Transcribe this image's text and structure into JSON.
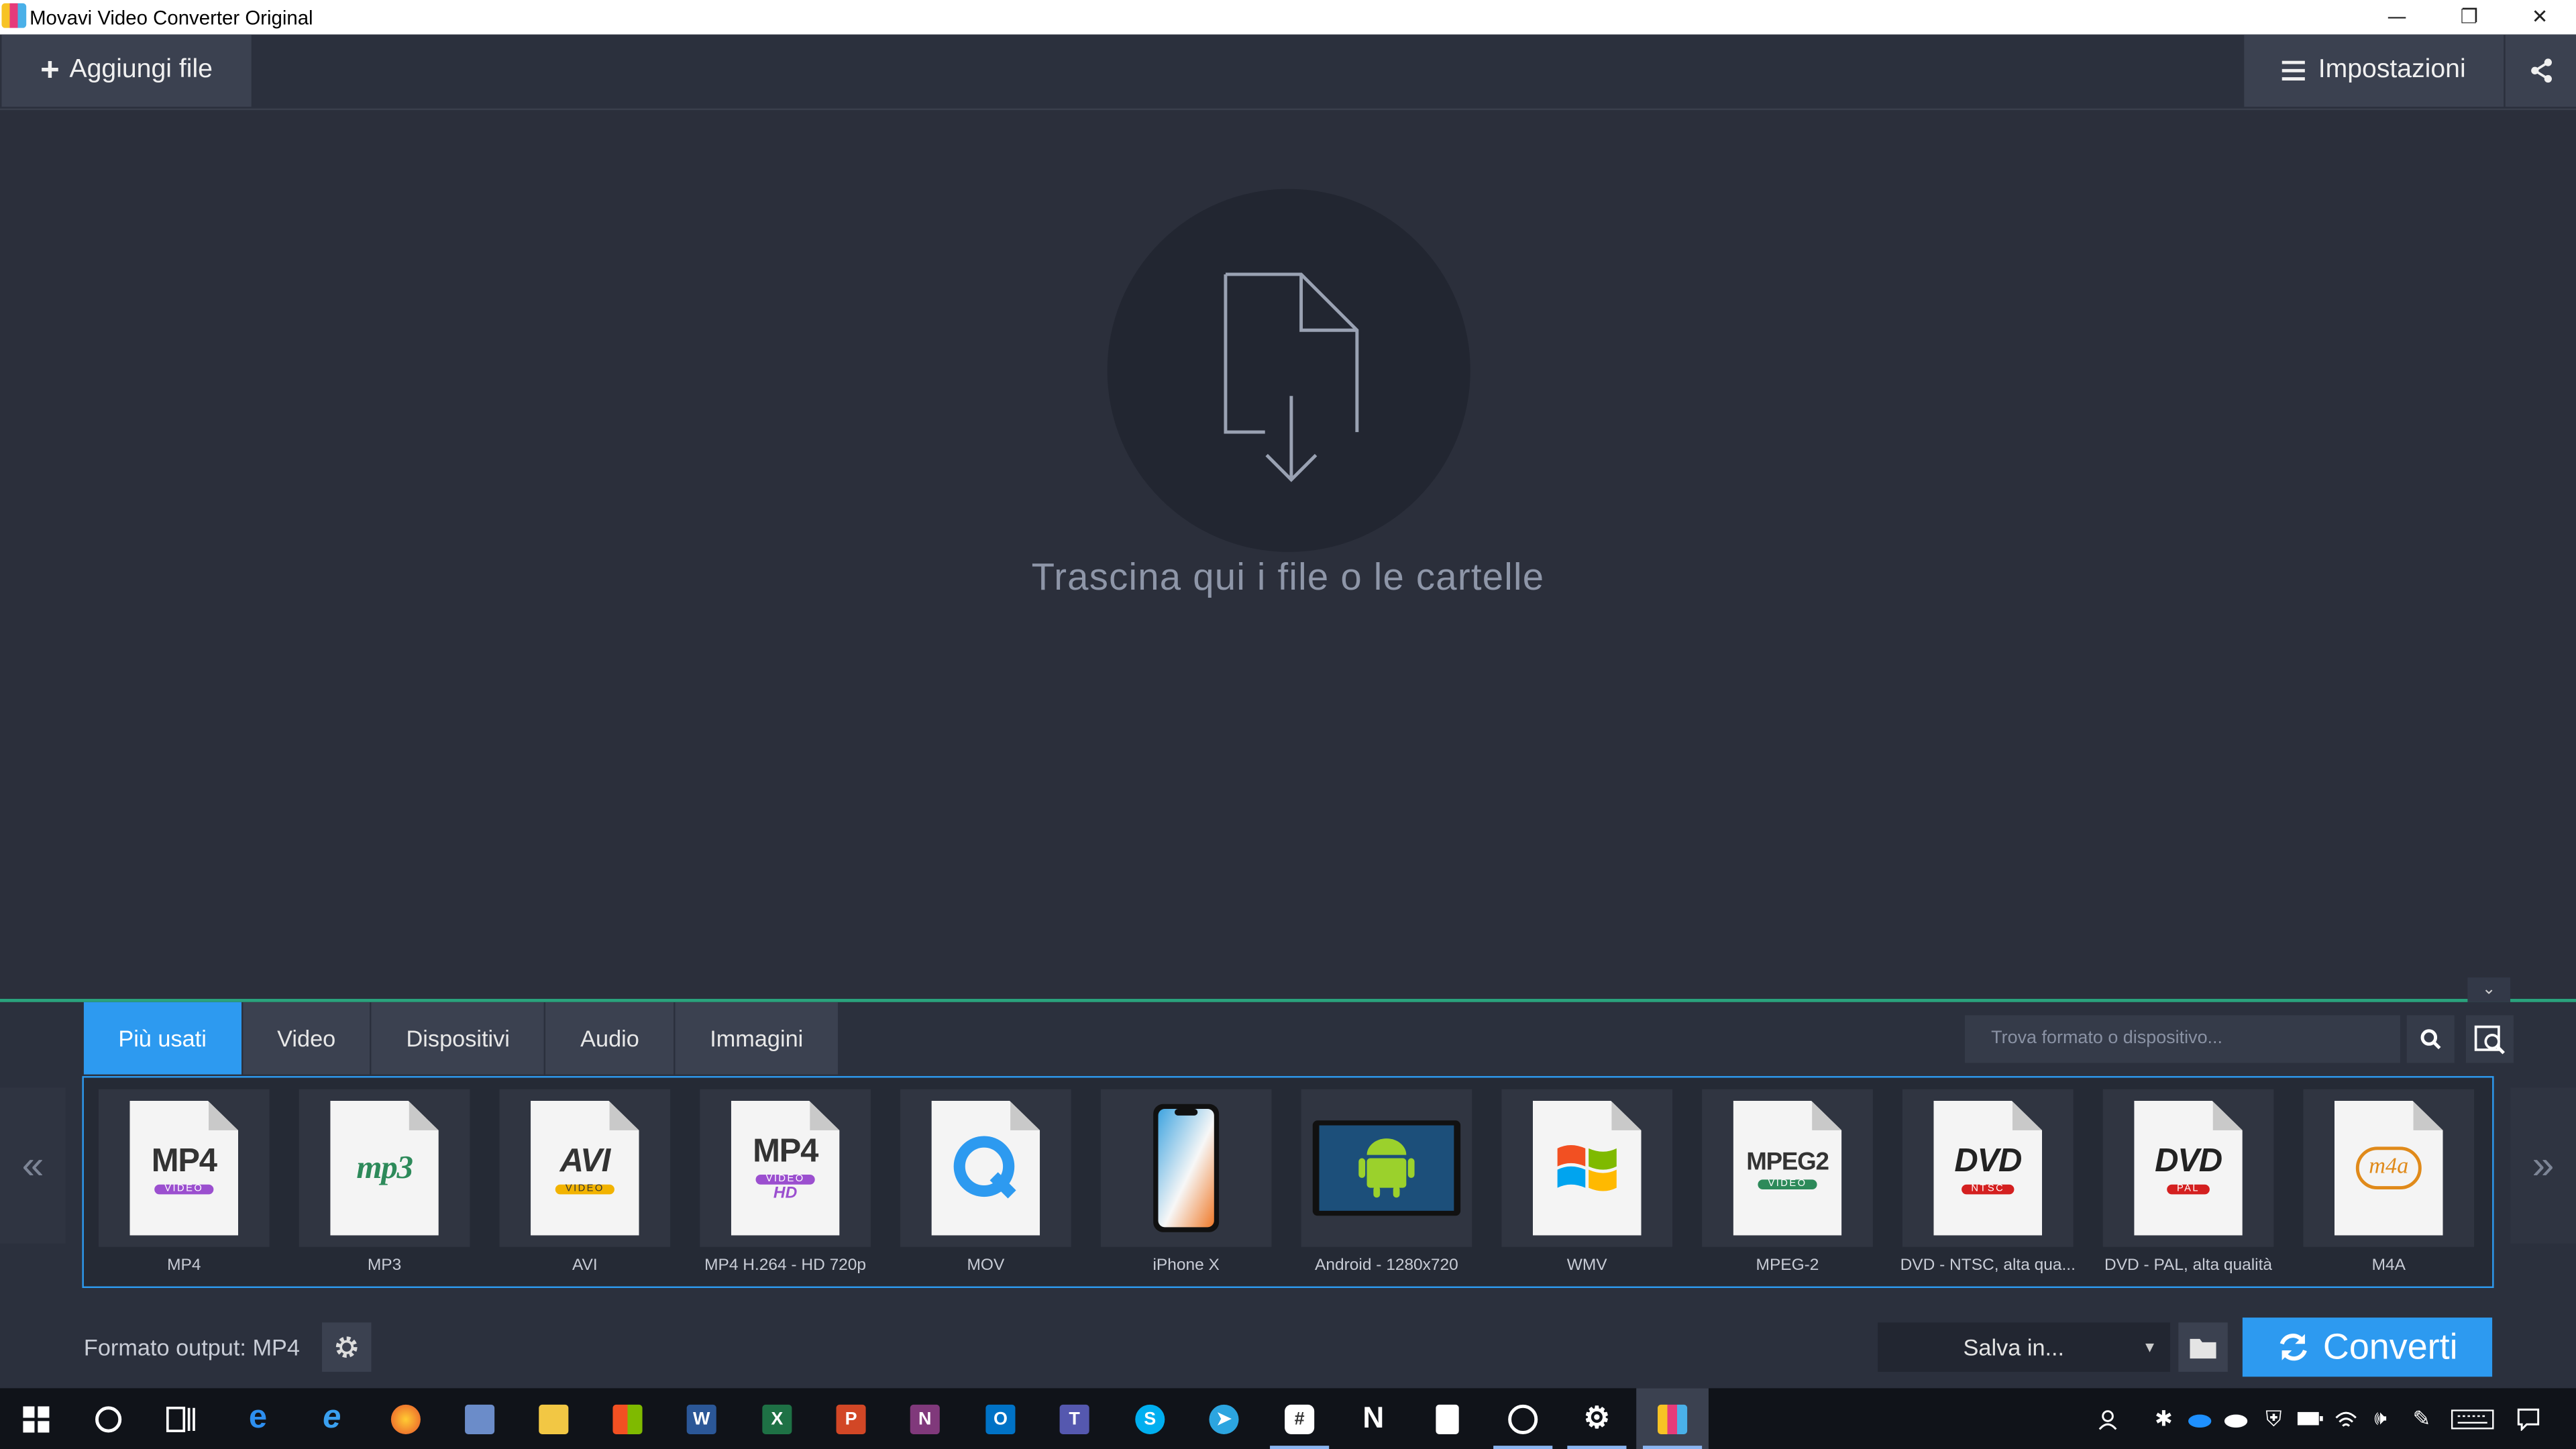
{
  "window": {
    "title": "Movavi Video Converter Original",
    "controls": [
      "—",
      "❐",
      "✕"
    ]
  },
  "toolbar": {
    "add_file_label": "Aggiungi file",
    "settings_label": "Impostazioni"
  },
  "dropzone": {
    "hint": "Trascina qui i file o le cartelle"
  },
  "tabs": [
    {
      "label": "Più usati",
      "active": true
    },
    {
      "label": "Video",
      "active": false
    },
    {
      "label": "Dispositivi",
      "active": false
    },
    {
      "label": "Audio",
      "active": false
    },
    {
      "label": "Immagini",
      "active": false
    }
  ],
  "search": {
    "placeholder": "Trova formato o dispositivo..."
  },
  "nav": {
    "prev": "«",
    "next": "»"
  },
  "formats": [
    {
      "label": "MP4",
      "badge": "MP4",
      "sub": "VIDEO"
    },
    {
      "label": "MP3",
      "badge": "mp3",
      "sub": ""
    },
    {
      "label": "AVI",
      "badge": "AVI",
      "sub": "VIDEO"
    },
    {
      "label": "MP4 H.264 - HD 720p",
      "badge": "MP4",
      "sub": "VIDEO",
      "extra": "HD"
    },
    {
      "label": "MOV",
      "badge": "Q",
      "sub": ""
    },
    {
      "label": "iPhone X",
      "badge": "",
      "sub": ""
    },
    {
      "label": "Android - 1280x720",
      "badge": "",
      "sub": ""
    },
    {
      "label": "WMV",
      "badge": "",
      "sub": ""
    },
    {
      "label": "MPEG-2",
      "badge": "MPEG2",
      "sub": "VIDEO"
    },
    {
      "label": "DVD - NTSC, alta qua...",
      "badge": "DVD",
      "sub": "NTSC"
    },
    {
      "label": "DVD - PAL, alta qualità",
      "badge": "DVD",
      "sub": "PAL"
    },
    {
      "label": "M4A",
      "badge": "m4a",
      "sub": ""
    }
  ],
  "footer": {
    "output_format": "Formato output: MP4",
    "save_in": "Salva in...",
    "convert": "Converti"
  },
  "colors": {
    "accent": "#2d9af0",
    "panel_line": "#2aa37d",
    "background": "#2b2f3b"
  },
  "taskbar": {
    "icons": [
      "windows-start",
      "search",
      "task-view",
      "edge",
      "internet-explorer",
      "firefox",
      "app-window",
      "file-explorer",
      "store",
      "word",
      "excel",
      "powerpoint",
      "onenote",
      "outlook",
      "teams",
      "skype",
      "telegram",
      "slack",
      "notion",
      "snip",
      "media",
      "settings",
      "movavi"
    ]
  }
}
